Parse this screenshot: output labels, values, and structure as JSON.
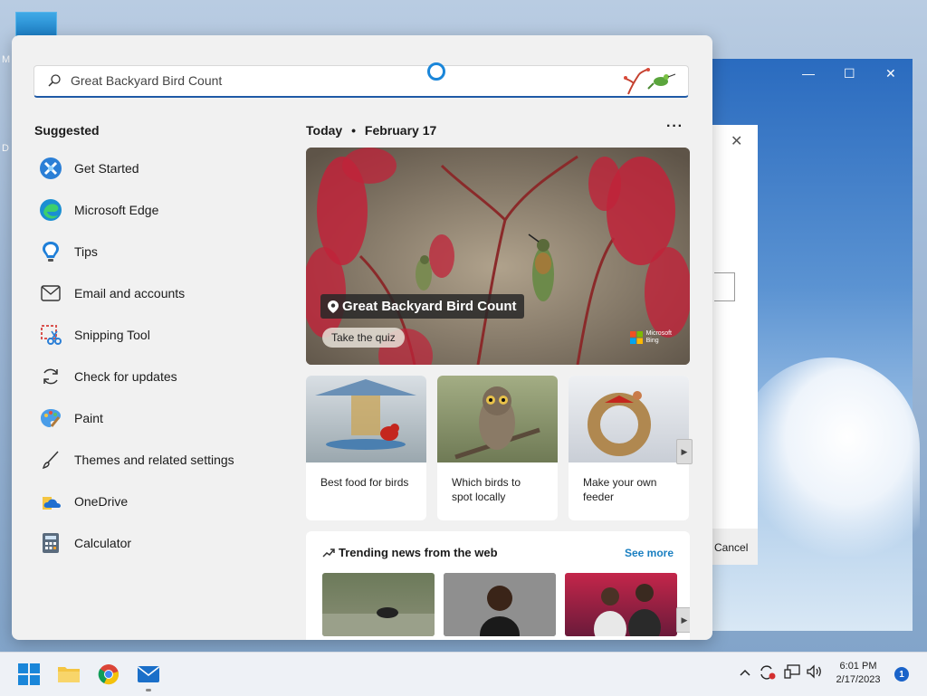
{
  "desktop": {
    "icon_label_1": "M",
    "icon_label_2": "D"
  },
  "background_window": {
    "minimize": "—",
    "maximize": "☐",
    "close": "✕",
    "dialog_close": "✕",
    "dialog_cancel": "Cancel"
  },
  "search": {
    "value": "Great Backyard Bird Count"
  },
  "suggested": {
    "title": "Suggested",
    "items": [
      {
        "label": "Get Started"
      },
      {
        "label": "Microsoft Edge"
      },
      {
        "label": "Tips"
      },
      {
        "label": "Email and accounts"
      },
      {
        "label": "Snipping Tool"
      },
      {
        "label": "Check for updates"
      },
      {
        "label": "Paint"
      },
      {
        "label": "Themes and related settings"
      },
      {
        "label": "OneDrive"
      },
      {
        "label": "Calculator"
      }
    ]
  },
  "today": {
    "label": "Today",
    "separator": "•",
    "date": "February 17",
    "more": "···"
  },
  "hero": {
    "title": "Great Backyard Bird Count",
    "button": "Take the quiz",
    "brand_line1": "Microsoft",
    "brand_line2": "Bing"
  },
  "cards": [
    {
      "caption": "Best food for birds"
    },
    {
      "caption": "Which birds to spot locally"
    },
    {
      "caption": "Make your own feeder"
    }
  ],
  "trending": {
    "title": "Trending news from the web",
    "see_more": "See more"
  },
  "taskbar": {
    "time": "6:01 PM",
    "date": "2/17/2023",
    "notification_count": "1",
    "tray_chevron": "^"
  },
  "colors": {
    "accent": "#1a63c9",
    "link": "#1a7fc1"
  }
}
